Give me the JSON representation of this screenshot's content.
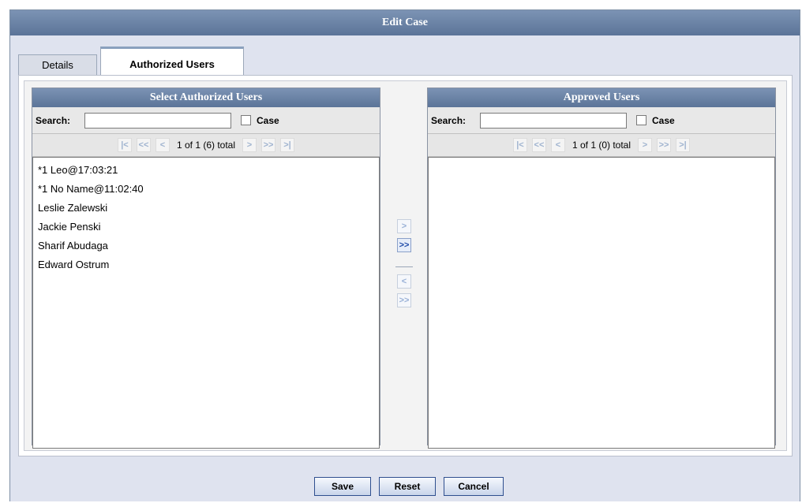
{
  "dialog": {
    "title": "Edit Case"
  },
  "tabs": [
    {
      "label": "Details",
      "active": false
    },
    {
      "label": "Authorized Users",
      "active": true
    }
  ],
  "left_panel": {
    "title": "Select Authorized Users",
    "search_label": "Search:",
    "search_value": "",
    "case_label": "Case",
    "case_checked": false,
    "pager_text": "1 of 1 (6) total",
    "items": [
      "*1 Leo@17:03:21",
      "*1 No Name@11:02:40",
      "Leslie Zalewski",
      "Jackie Penski",
      "Sharif Abudaga",
      "Edward Ostrum"
    ]
  },
  "right_panel": {
    "title": "Approved Users",
    "search_label": "Search:",
    "search_value": "",
    "case_label": "Case",
    "case_checked": false,
    "pager_text": "1 of 1 (0) total",
    "items": []
  },
  "pager_buttons": {
    "first": "|<",
    "prev_page": "<<",
    "prev": "<",
    "next": ">",
    "next_page": ">>",
    "last": ">|"
  },
  "move_buttons": {
    "add_one": ">",
    "add_all": ">>",
    "remove_one": "<",
    "remove_all": ">>"
  },
  "footer": {
    "save": "Save",
    "reset": "Reset",
    "cancel": "Cancel"
  },
  "colors": {
    "header": "#6a83a7",
    "accent_active": "#1e4aa8",
    "background": "#dfe3ef"
  }
}
